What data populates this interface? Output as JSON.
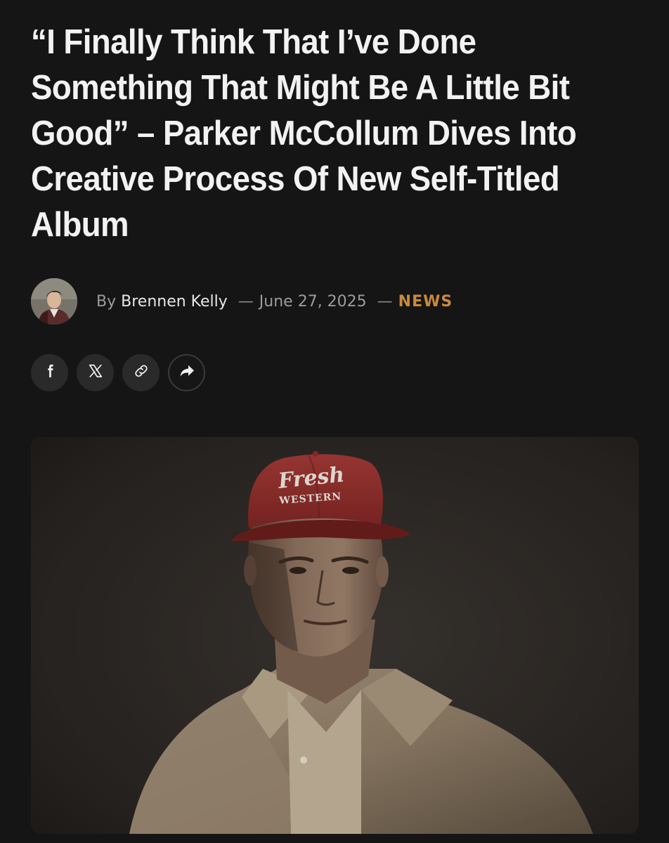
{
  "article": {
    "title": "“I Finally Think That I’ve Done Something That Might Be A Little Bit Good” – Parker McCollum Dives Into Creative Process Of New Self-Titled Album",
    "byline_prefix": "By",
    "author": "Brennen Kelly",
    "separator": "—",
    "date": "June 27, 2025",
    "category": "NEWS"
  },
  "share": {
    "buttons": [
      {
        "icon": "facebook-icon"
      },
      {
        "icon": "x-icon"
      },
      {
        "icon": "link-icon"
      },
      {
        "icon": "share-arrow-icon"
      }
    ]
  },
  "hero_image": {
    "cap_text_line1": "Fresh",
    "cap_text_line2": "WESTERN"
  },
  "colors": {
    "background": "#151515",
    "text": "#f2f2f2",
    "meta": "#9b9b9b",
    "accent": "#c98a3c",
    "button_bg": "#2a2a2a"
  }
}
